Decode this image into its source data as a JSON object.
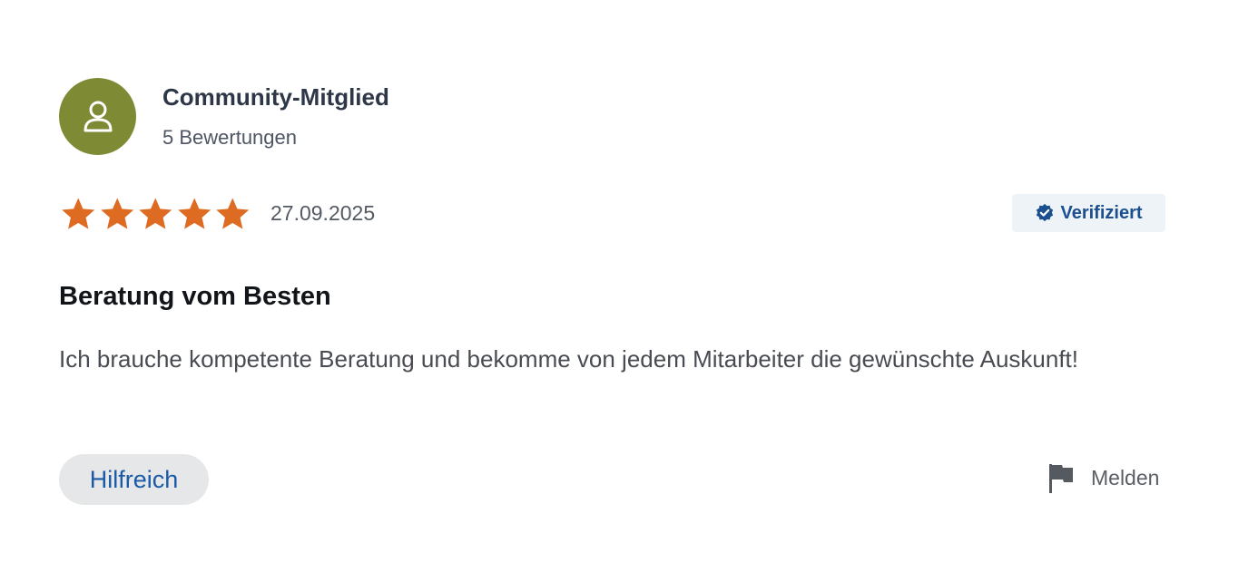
{
  "author": {
    "name": "Community-Mitglied",
    "review_count": "5 Bewertungen",
    "avatar_icon": "user-icon",
    "avatar_color": "#7f8a35"
  },
  "rating": {
    "stars": 5,
    "max_stars": 5,
    "star_color": "#de6b22",
    "date": "27.09.2025"
  },
  "verified_badge": {
    "label": "Verifiziert",
    "icon": "verified-check-icon",
    "color": "#1b4f8f"
  },
  "review": {
    "title": "Beratung vom Besten",
    "text": "Ich brauche kompetente Beratung und bekomme von jedem Mitarbeiter die gewünschte Auskunft!"
  },
  "actions": {
    "helpful_label": "Hilfreich",
    "report_label": "Melden",
    "report_icon": "flag-icon"
  }
}
